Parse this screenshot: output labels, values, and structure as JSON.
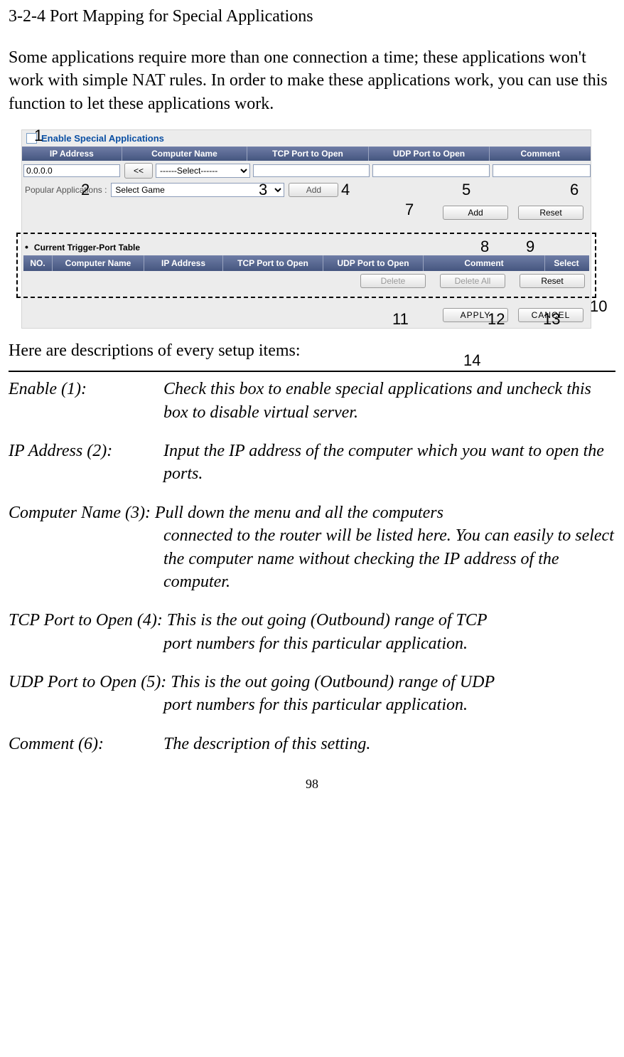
{
  "title": "3-2-4 Port Mapping for Special Applications",
  "intro": "Some applications require more than one connection a time; these applications won't work with simple NAT rules. In order to make these applications work, you can use this function to let these applications work.",
  "screenshot": {
    "enable_label": "Enable Special Applications",
    "headers": {
      "ip": "IP Address",
      "name": "Computer Name",
      "tcp": "TCP Port to Open",
      "udp": "UDP Port to Open",
      "comment": "Comment"
    },
    "ip_value": "0.0.0.0",
    "arrow_btn": "<<",
    "select_placeholder": "------Select------",
    "popular_label": "Popular Applications  :",
    "game_select": "Select Game",
    "add_btn": "Add",
    "reset_btn": "Reset",
    "table_title": "Current Trigger-Port Table",
    "headers2": {
      "no": "NO.",
      "name": "Computer Name",
      "ip": "IP Address",
      "tcp": "TCP Port to Open",
      "udp": "UDP Port to Open",
      "comment": "Comment",
      "select": "Select"
    },
    "delete_btn": "Delete",
    "delete_all_btn": "Delete All",
    "apply_btn": "APPLY",
    "cancel_btn": "CANCEL"
  },
  "annotations": {
    "a1": "1",
    "a2": "2",
    "a3": "3",
    "a4": "4",
    "a5": "5",
    "a6": "6",
    "a7": "7",
    "a8": "8",
    "a9": "9",
    "a10": "10",
    "a11": "11",
    "a12": "12",
    "a13": "13",
    "a14": "14"
  },
  "desc_intro": "Here are descriptions of every setup items:",
  "items": {
    "enable": {
      "label": "Enable (1):",
      "text": "Check this box to enable special applications and uncheck this box to disable virtual server."
    },
    "ip": {
      "label": "IP Address (2):",
      "text": "Input the IP address of the computer which you want to open the ports."
    },
    "name": {
      "label": "Computer Name (3):",
      "text": "Pull down the menu and all the computers connected to the router will be listed here. You can easily to select the computer name without checking the IP address of the computer."
    },
    "tcp": {
      "label": "TCP Port to Open (4):",
      "text": "This is the out going (Outbound) range of TCP port numbers for this particular application."
    },
    "udp": {
      "label": "UDP Port to Open (5):",
      "text": "This is the out going (Outbound) range of UDP port numbers for this particular application."
    },
    "comment": {
      "label": "Comment (6):",
      "text": "The description of this setting."
    }
  },
  "page_number": "98"
}
